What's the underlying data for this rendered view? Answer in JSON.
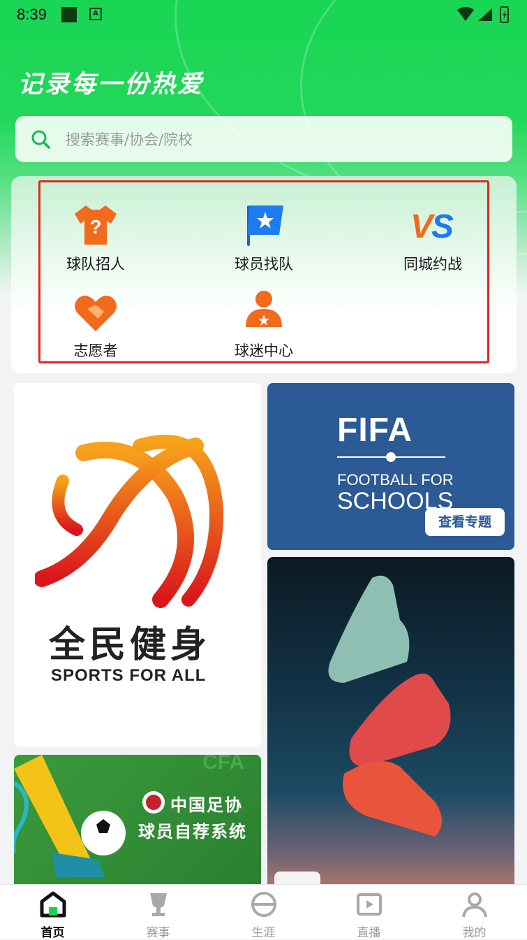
{
  "status_bar": {
    "time": "8:39"
  },
  "header": {
    "slogan": "记录每一份热爱"
  },
  "search": {
    "placeholder": "搜索赛事/协会/院校",
    "icon": "search-icon"
  },
  "shortcuts": [
    {
      "label": "球队招人",
      "icon": "shirt-question-icon"
    },
    {
      "label": "球员找队",
      "icon": "star-flag-icon"
    },
    {
      "label": "同城约战",
      "icon": "vs-icon"
    },
    {
      "label": "志愿者",
      "icon": "heart-hands-icon"
    },
    {
      "label": "球迷中心",
      "icon": "fan-person-icon"
    }
  ],
  "banners": {
    "sports_for_all": {
      "title_cn": "全民健身",
      "title_en": "SPORTS FOR ALL"
    },
    "fifa": {
      "brand": "FIFA",
      "line1": "FOOTBALL FOR",
      "line2": "SCHOOLS",
      "button": "查看专题"
    },
    "cfa": {
      "line1": "中国足协",
      "line2": "球员自荐系统",
      "badge": "CFA"
    },
    "boots": {}
  },
  "nav": [
    {
      "label": "首页",
      "icon": "home-icon",
      "active": true
    },
    {
      "label": "赛事",
      "icon": "trophy-icon",
      "active": false
    },
    {
      "label": "生涯",
      "icon": "ball-icon",
      "active": false
    },
    {
      "label": "直播",
      "icon": "play-icon",
      "active": false
    },
    {
      "label": "我的",
      "icon": "user-icon",
      "active": false
    }
  ],
  "colors": {
    "brand_green": "#18d653",
    "highlight_red": "#e2261e",
    "icon_orange": "#f26a1b",
    "fifa_blue": "#2b5a94"
  }
}
